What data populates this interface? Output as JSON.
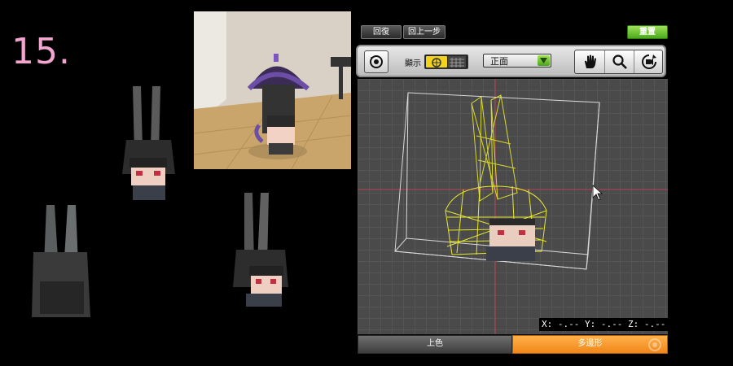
{
  "step_label": "15.",
  "top_buttons": {
    "undo": "回復",
    "back_step": "回上一步",
    "reset": "重置"
  },
  "toolbar": {
    "display_label": "顯示",
    "view_select_value": "正面"
  },
  "coordinates": "X: -.-- Y: -.-- Z: -.--",
  "tabs": {
    "color": "上色",
    "polygon": "多邊形"
  },
  "colors": {
    "accent_green": "#6cc72a",
    "accent_orange": "#f39422",
    "wireframe_yellow": "#e9e82e",
    "step_pink": "#f2a6cf"
  },
  "icons": {
    "reset_view": "rotate-reset-icon",
    "hand": "hand-icon",
    "zoom": "magnifier-icon",
    "camera": "camera-rotate-icon"
  }
}
